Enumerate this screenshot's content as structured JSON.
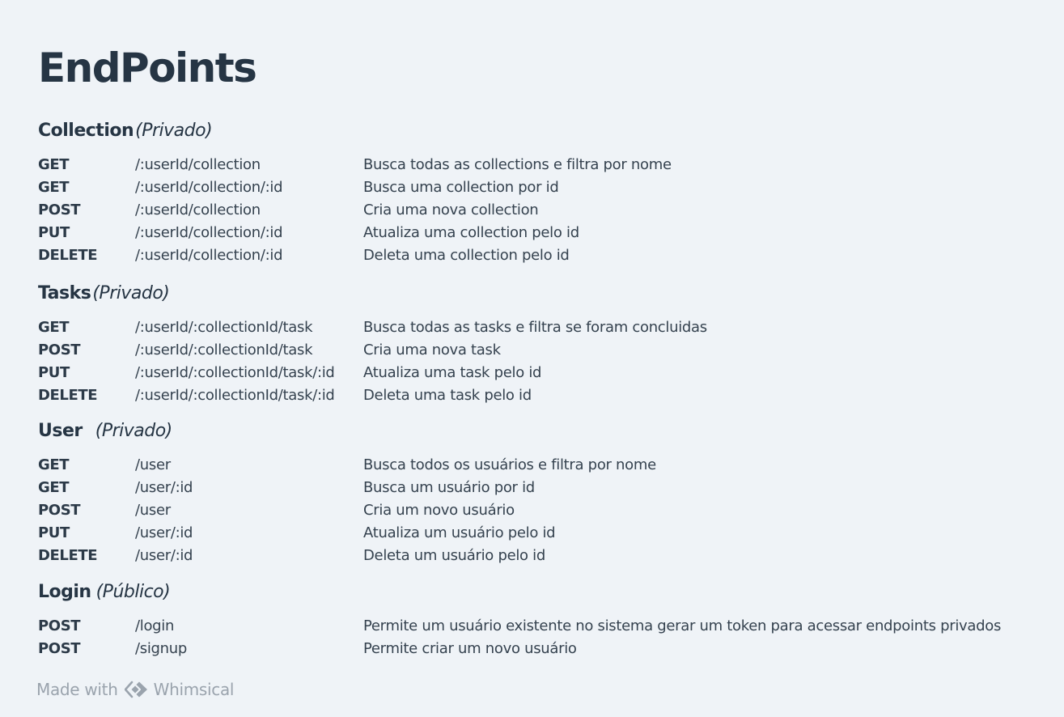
{
  "title": "EndPoints",
  "sections": [
    {
      "name": "Collection",
      "access": "(Privado)",
      "rows": [
        {
          "method": "GET",
          "path": "/:userId/collection",
          "description": "Busca todas as collections e filtra por nome"
        },
        {
          "method": "GET",
          "path": "/:userId/collection/:id",
          "description": "Busca uma collection por id"
        },
        {
          "method": "POST",
          "path": "/:userId/collection",
          "description": "Cria uma nova collection"
        },
        {
          "method": "PUT",
          "path": "/:userId/collection/:id",
          "description": "Atualiza uma collection pelo id"
        },
        {
          "method": "DELETE",
          "path": "/:userId/collection/:id",
          "description": "Deleta uma collection pelo id"
        }
      ]
    },
    {
      "name": "Tasks",
      "access": "(Privado)",
      "rows": [
        {
          "method": "GET",
          "path": "/:userId/:collectionId/task",
          "description": "Busca todas as tasks e filtra se foram concluidas"
        },
        {
          "method": "POST",
          "path": "/:userId/:collectionId/task",
          "description": "Cria uma nova task"
        },
        {
          "method": "PUT",
          "path": "/:userId/:collectionId/task/:id",
          "description": "Atualiza uma task pelo id"
        },
        {
          "method": "DELETE",
          "path": "/:userId/:collectionId/task/:id",
          "description": "Deleta uma task pelo id"
        }
      ]
    },
    {
      "name": "User",
      "access": "(Privado)",
      "rows": [
        {
          "method": "GET",
          "path": "/user",
          "description": "Busca todos os usuários e filtra por nome"
        },
        {
          "method": "GET",
          "path": "/user/:id",
          "description": "Busca um usuário por id"
        },
        {
          "method": "POST",
          "path": "/user",
          "description": "Cria um novo usuário"
        },
        {
          "method": "PUT",
          "path": "/user/:id",
          "description": "Atualiza um usuário pelo id"
        },
        {
          "method": "DELETE",
          "path": "/user/:id",
          "description": "Deleta um usuário pelo id"
        }
      ]
    },
    {
      "name": "Login",
      "access": "(Público)",
      "rows": [
        {
          "method": "POST",
          "path": "/login",
          "description": "Permite um usuário existente no sistema gerar um token para acessar endpoints privados"
        },
        {
          "method": "POST",
          "path": "/signup",
          "description": "Permite criar um novo usuário"
        }
      ]
    }
  ],
  "footer": {
    "made_with": "Made with",
    "brand": "Whimsical",
    "logo_icon": "whimsical-logo-icon"
  }
}
